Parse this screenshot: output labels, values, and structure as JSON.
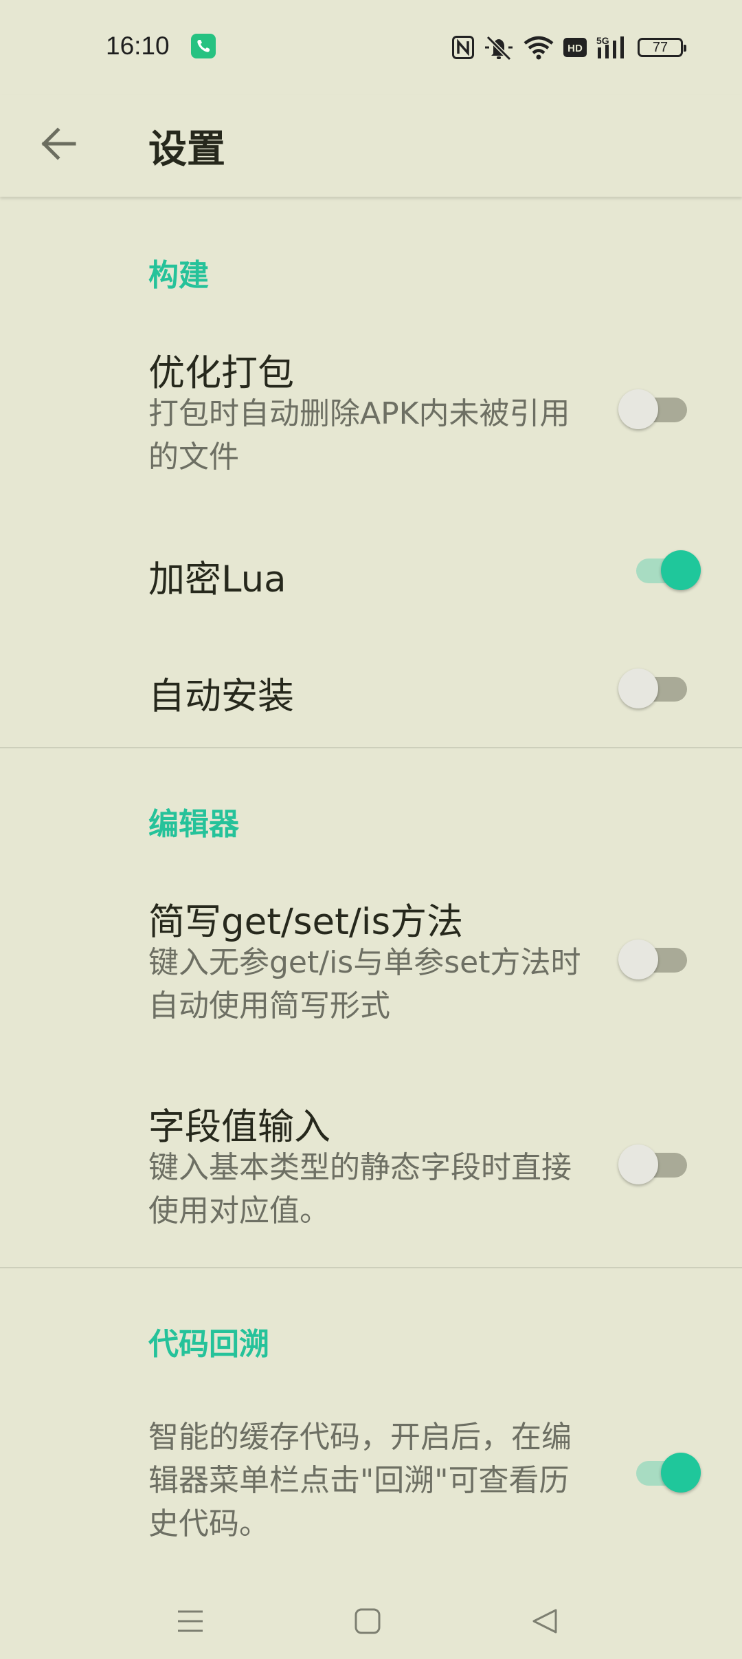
{
  "status_bar": {
    "time": "16:10",
    "battery": "77",
    "icons": [
      "phone-call-icon",
      "nfc-icon",
      "mute-icon",
      "wifi-icon",
      "hd-icon",
      "signal-5g-icon",
      "battery-icon"
    ]
  },
  "toolbar": {
    "title": "设置",
    "back_icon": "arrow-back-icon"
  },
  "colors": {
    "background": "#e6e7d2",
    "accent": "#1fc79b",
    "section_header": "#25c29a",
    "text_primary": "#26281c",
    "text_secondary": "#6d6f63"
  },
  "sections": [
    {
      "header": "构建",
      "items": [
        {
          "title": "优化打包",
          "summary": "打包时自动删除APK内未被引用的文件",
          "checked": false
        },
        {
          "title": "加密Lua",
          "summary": "",
          "checked": true
        },
        {
          "title": "自动安装",
          "summary": "",
          "checked": false
        }
      ]
    },
    {
      "header": "编辑器",
      "items": [
        {
          "title": "简写get/set/is方法",
          "summary": "键入无参get/is与单参set方法时自动使用简写形式",
          "checked": false
        },
        {
          "title": "字段值输入",
          "summary": "键入基本类型的静态字段时直接使用对应值。",
          "checked": false
        }
      ]
    },
    {
      "header": "代码回溯",
      "items": [
        {
          "title": "",
          "summary": "智能的缓存代码，开启后，在编辑器菜单栏点击\"回溯\"可查看历史代码。",
          "checked": true
        }
      ]
    }
  ],
  "nav_bar": {
    "icons": [
      "menu-icon",
      "home-icon",
      "back-triangle-icon"
    ]
  }
}
